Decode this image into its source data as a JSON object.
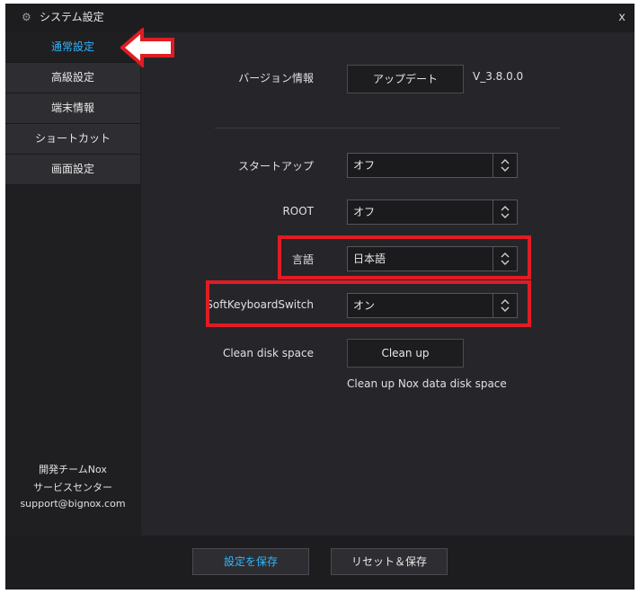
{
  "window": {
    "title": "システム設定",
    "close_label": "x"
  },
  "sidebar": {
    "items": [
      {
        "label": "通常設定"
      },
      {
        "label": "高級設定"
      },
      {
        "label": "端末情報"
      },
      {
        "label": "ショートカット"
      },
      {
        "label": "画面設定"
      }
    ],
    "footer": {
      "line1": "開発チームNox",
      "line2": "サービスセンター",
      "line3": "support@bignox.com"
    }
  },
  "main": {
    "version": {
      "label": "バージョン情報",
      "button": "アップデート",
      "value": "V_3.8.0.0"
    },
    "startup": {
      "label": "スタートアップ",
      "value": "オフ"
    },
    "root": {
      "label": "ROOT",
      "value": "オフ"
    },
    "language": {
      "label": "言語",
      "value": "日本語"
    },
    "softkeyboard": {
      "label": "SoftKeyboardSwitch",
      "value": "オン"
    },
    "cleandisk": {
      "label": "Clean disk space",
      "button": "Clean up",
      "hint": "Clean up Nox data disk space"
    }
  },
  "footer": {
    "save": "設定を保存",
    "reset": "リセット＆保存"
  },
  "colors": {
    "accent": "#2fb6ff",
    "highlight_red": "#e01c24"
  }
}
